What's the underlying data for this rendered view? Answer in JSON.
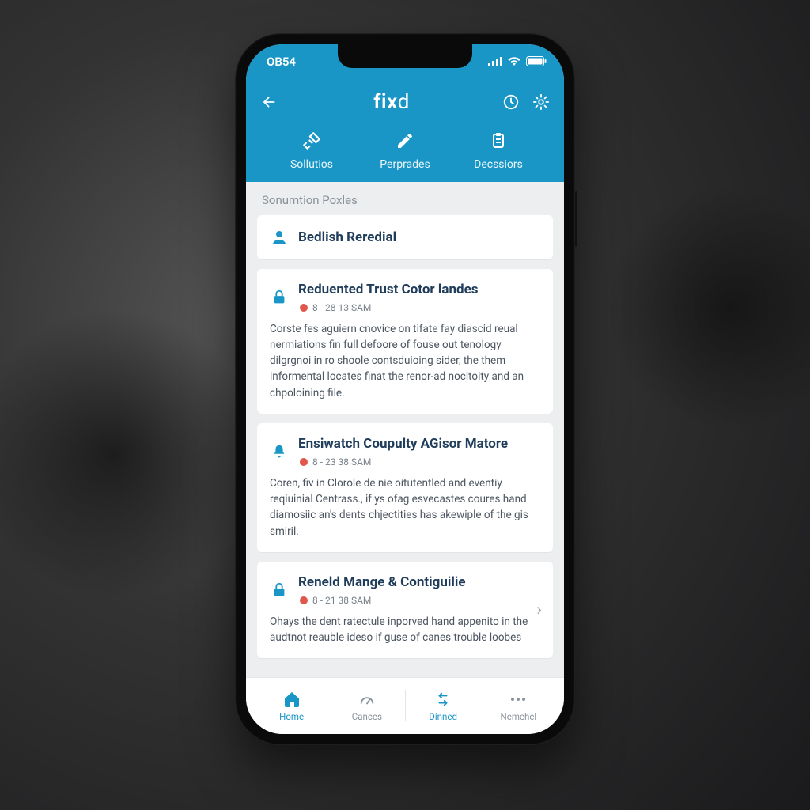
{
  "status": {
    "left": "OB54"
  },
  "header": {
    "title_a": "fix",
    "title_b": "d"
  },
  "tabs": [
    {
      "label": "Sollutios"
    },
    {
      "label": "Perprades"
    },
    {
      "label": "Decssiors"
    }
  ],
  "section_label": "Sonumtion Poxles",
  "cards": [
    {
      "title": "Bedlish Reredial"
    },
    {
      "title": "Reduented Trust Cotor landes",
      "time": "8 - 28 13 SAM",
      "body": "Corste fes aguiern cnovice on tifate fay diascid reual nermiations fin full defoore of fouse out tenology dilgrgnoi in ro shoole contsduioing sider, the them informental locates finat the renor-ad nocitoity and an chpoloining file."
    },
    {
      "title": "Ensiwatch Coupulty AGisor Matore",
      "time": "8 - 23 38 SAM",
      "body": "Coren, fiv in Clorole de nie oitutentled and eventiy reqiuinial Centrass., if ys ofag esvecastes coures hand diamosiic an's dents chjectities has akewiple of the gis smiril."
    },
    {
      "title": "Reneld Mange & Contiguilie",
      "time": "8 - 21 38 SAM",
      "body": "Ohays the dent ratectule inporved hand appenito in the audtnot reauble ideso if guse of canes trouble loobes"
    }
  ],
  "nav": [
    {
      "label": "Home"
    },
    {
      "label": "Cances"
    },
    {
      "label": "Dinned"
    },
    {
      "label": "Nemehel"
    }
  ]
}
